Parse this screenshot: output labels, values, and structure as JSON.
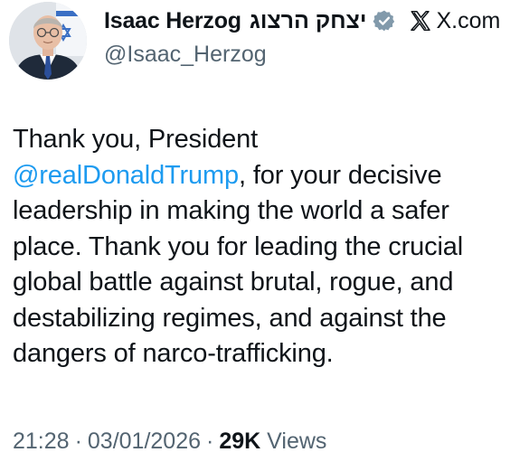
{
  "author": {
    "display_name": "Isaac Herzog",
    "hebrew_name": "יצחק הרצוג",
    "handle": "@Isaac_Herzog",
    "site": "X.com",
    "verified": true
  },
  "tweet": {
    "lines": {
      "l1": "Thank you, President",
      "l2_mention": "@realDonaldTrump",
      "l2_rest": ", for your decisive",
      "l3": "leadership in making the world a safer",
      "l4": "place. Thank you for leading the crucial",
      "l5": "global battle against brutal, rogue, and",
      "l6": "destabilizing regimes, and against the",
      "l7": "dangers of narco-trafficking."
    }
  },
  "meta": {
    "time": "21:28",
    "separator": "·",
    "date": "03/01/2026",
    "views_count": "29K",
    "views_label": "Views"
  },
  "colors": {
    "text": "#0f1419",
    "secondary": "#536471",
    "accent": "#1d9bf0",
    "verified_badge": "#829aab"
  }
}
